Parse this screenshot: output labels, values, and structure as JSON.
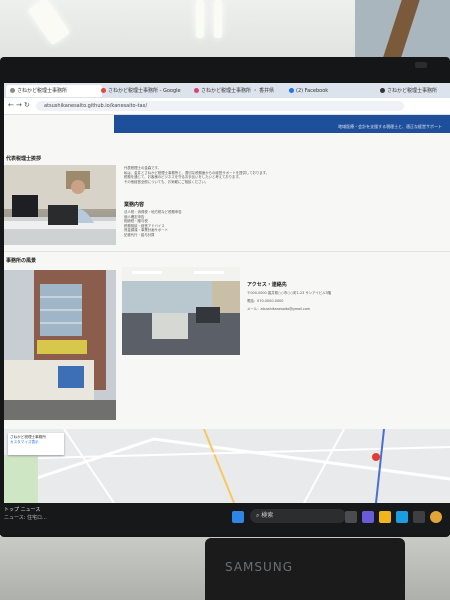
{
  "tabs": [
    {
      "label": "さねかど税理士事務所",
      "color": "#8a8a8a",
      "active": true
    },
    {
      "label": "さねかど税理士事務所 - Google",
      "color": "#e8453c",
      "active": false
    },
    {
      "label": "さねかど税理士事務所 ・ 香井県",
      "color": "#d9417a",
      "active": false
    },
    {
      "label": "(2) Facebook",
      "color": "#1877f2",
      "active": false
    },
    {
      "label": "さねかど税理士事務所",
      "color": "#333333",
      "active": false
    }
  ],
  "address_bar": {
    "url": "atsushikanesaito.github.io/kanesaito-tax/"
  },
  "header": {
    "top_text": "",
    "sub_text": "地域医療・会計を支援する税理士と、適正な経営サポート"
  },
  "profile": {
    "title": "代表税理士挨拶",
    "body": [
      "代表税理士の金森です。",
      "私は、金井とさねかど税理士事務所と、適切な税務面からの経営サポートを提供しております。",
      "税務を通じて、お客様のビジネスを守るお手伝いをしたいと考えております。",
      "その他経営全般についても、お気軽にご相談ください。"
    ]
  },
  "services": {
    "title": "業務内容",
    "items": [
      "法人税・消費税・地方税など税務申告",
      "個人確定申告",
      "相続税・贈与税",
      "税務相談・経営アドバイス",
      "資金調達・事業計画サポート",
      "記帳代行・給与計算"
    ]
  },
  "office": {
    "title": "事務所の風景"
  },
  "access": {
    "title": "アクセス・連絡先",
    "address": "〒000-0000 香井県○○市○○町1-23 サンアイビル3階",
    "phone": "電話：070-0000-0000",
    "email": "メール：atsushikanesaito@gmail.com"
  },
  "map": {
    "card_title": "さねかど税理士事務所",
    "card_sub": "カスタマイズ表示"
  },
  "taskbar": {
    "news_title": "トップ ニュース",
    "news_sub": "ニュース: 住宅ロ...",
    "search_placeholder": "検索"
  },
  "stand": {
    "brand": "SAMSUNG"
  }
}
